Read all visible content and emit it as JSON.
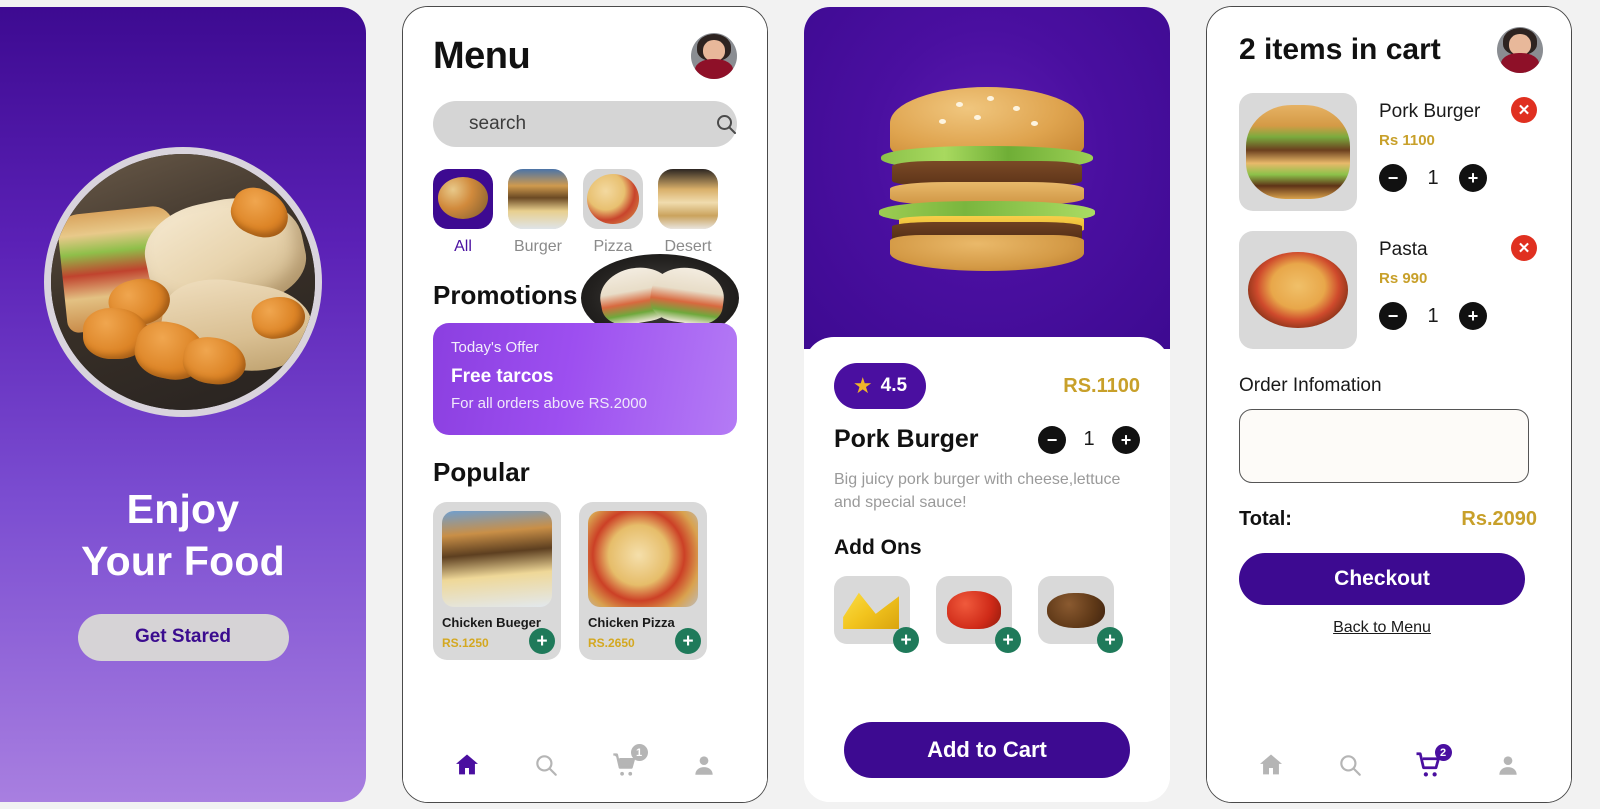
{
  "theme": {
    "deep_purple": "#3d0a91",
    "light_purple": "#a87fe0",
    "accent_gold": "#c8a02a",
    "green_add": "#1f7a5a",
    "delete_red": "#e03020"
  },
  "splash": {
    "title_line1": "Enjoy",
    "title_line2": "Your Food",
    "cta_label": "Get Stared",
    "hero_icon": "food-collage-image"
  },
  "menu": {
    "title": "Menu",
    "avatar_icon": "user-avatar",
    "search": {
      "placeholder": "search",
      "value": "",
      "icon": "search-icon"
    },
    "categories": [
      {
        "label": "All",
        "active": true,
        "icon": "all-food-thumb"
      },
      {
        "label": "Burger",
        "active": false,
        "icon": "burger-thumb"
      },
      {
        "label": "Pizza",
        "active": false,
        "icon": "pizza-thumb"
      },
      {
        "label": "Desert",
        "active": false,
        "icon": "desert-thumb"
      }
    ],
    "promotions_heading": "Promotions",
    "promo": {
      "subtitle": "Today's Offer",
      "title": "Free tarcos",
      "note": "For all orders above RS.2000",
      "image_icon": "tacos-plate-image"
    },
    "popular_heading": "Popular",
    "popular": [
      {
        "name": "Chicken Bueger",
        "price": "RS.1250",
        "add_label": "+",
        "icon": "burger-plate-image"
      },
      {
        "name": "Chicken Pizza",
        "price": "RS.2650",
        "add_label": "+",
        "icon": "pizza-image"
      }
    ],
    "tabbar": {
      "home": "home-icon",
      "search": "search-icon",
      "cart": "cart-icon",
      "profile": "profile-icon",
      "cart_badge": "1",
      "active": "home"
    }
  },
  "detail": {
    "hero_icon": "pork-burger-image",
    "rating": "4.5",
    "rating_icon": "star-icon",
    "price": "RS.1100",
    "name": "Pork Burger",
    "quantity": "1",
    "minus_label": "−",
    "plus_label": "+",
    "description": "Big juicy pork burger with cheese,lettuce and special sauce!",
    "addons_heading": "Add Ons",
    "addons": [
      {
        "icon": "cheese-icon",
        "add_label": "+"
      },
      {
        "icon": "tomato-sauce-icon",
        "add_label": "+"
      },
      {
        "icon": "beef-patty-icon",
        "add_label": "+"
      }
    ],
    "cta_label": "Add to Cart"
  },
  "cart": {
    "title": "2 items in cart",
    "avatar_icon": "user-avatar",
    "items": [
      {
        "name": "Pork Burger",
        "price": "Rs 1100",
        "quantity": "1",
        "icon": "pork-burger-image",
        "minus_label": "−",
        "plus_label": "+",
        "delete_label": "✕"
      },
      {
        "name": "Pasta",
        "price": "Rs 990",
        "quantity": "1",
        "icon": "pasta-image",
        "minus_label": "−",
        "plus_label": "+",
        "delete_label": "✕"
      }
    ],
    "order_info_label": "Order Infomation",
    "order_info_value": "",
    "total_label": "Total:",
    "total_value": "Rs.2090",
    "checkout_label": "Checkout",
    "back_label": "Back to Menu",
    "tabbar": {
      "home": "home-icon",
      "search": "search-icon",
      "cart": "cart-icon",
      "profile": "profile-icon",
      "cart_badge": "2",
      "active": "cart"
    }
  }
}
